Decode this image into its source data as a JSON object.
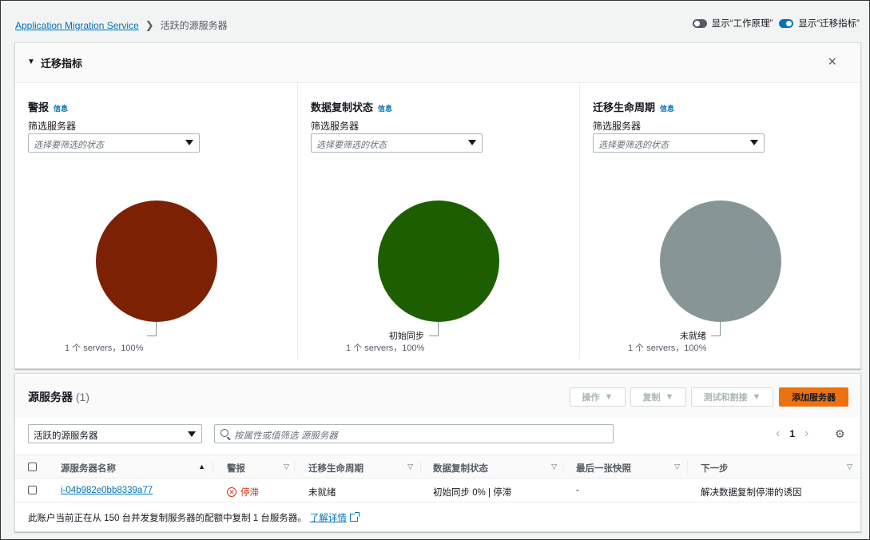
{
  "breadcrumb": {
    "root": "Application Migration Service",
    "current": "活跃的源服务器"
  },
  "toggles": [
    {
      "label": "显示“工作原理”",
      "state": "off"
    },
    {
      "label": "显示“迁移指标”",
      "state": "on"
    }
  ],
  "metrics": {
    "title": "迁移指标",
    "close_icon": "×",
    "info": "信息",
    "filter_label": "筛选服务器",
    "filter_placeholder": "选择要筛选的状态",
    "columns": [
      {
        "title": "警报",
        "color": "#7d2105",
        "slice_label": "",
        "summary": "1 个 servers，100%"
      },
      {
        "title": "数据复制状态",
        "color": "#1d5f00",
        "slice_label": "初始同步",
        "summary": "1 个 servers，100%"
      },
      {
        "title": "迁移生命周期",
        "color": "#879596",
        "slice_label": "未就绪",
        "summary": "1 个 servers，100%"
      }
    ]
  },
  "servers": {
    "title": "源服务器",
    "count": "(1)",
    "buttons": {
      "actions": "操作",
      "replication": "复制",
      "test_cutover": "测试和割接",
      "add": "添加服务器"
    },
    "filter_value": "活跃的源服务器",
    "search_placeholder": "按属性或值筛选 源服务器",
    "page": "1",
    "headers": [
      "源服务器名称",
      "警报",
      "迁移生命周期",
      "数据复制状态",
      "最后一张快照",
      "下一步"
    ],
    "rows": [
      {
        "name": "i-04b982e0bb8339a77",
        "alert": "停滞",
        "lifecycle": "未就绪",
        "replication": "初始同步 0% | 停滞",
        "snapshot": "-",
        "next_step": "解决数据复制停滞的诱因"
      }
    ],
    "footer_text": "此账户当前正在从 150 台并发复制服务器的配额中复制 1 台服务器。",
    "footer_link": "了解详情"
  }
}
